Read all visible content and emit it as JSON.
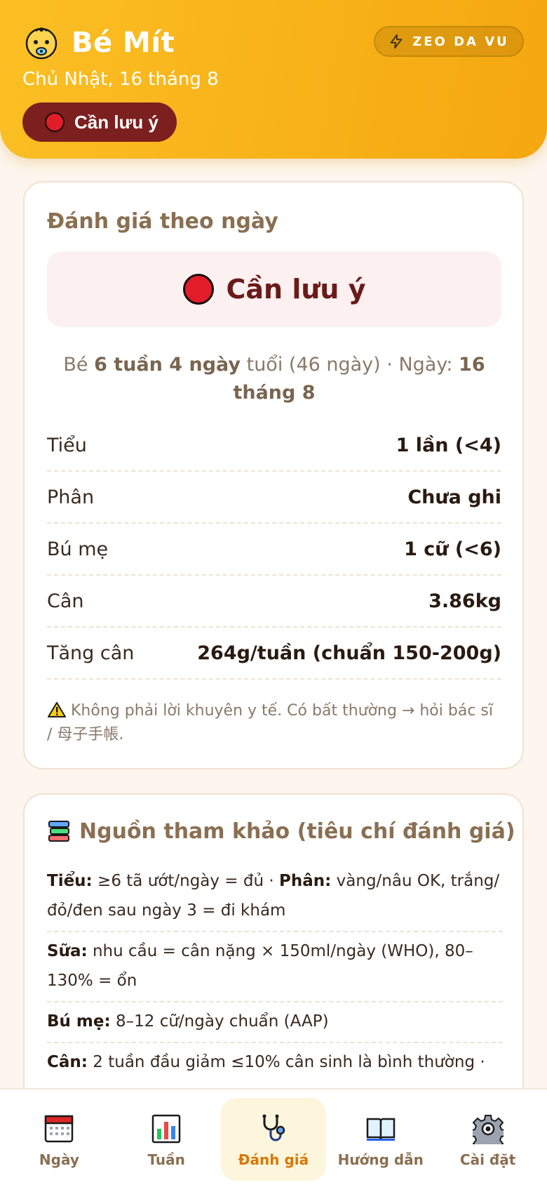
{
  "header": {
    "app_title": "Bé Mít",
    "date": "Chủ Nhật, 16 tháng 8",
    "status_label": "Cần lưu ý",
    "mode_label": "ZEO DA VU",
    "baby_icon": "baby-face-icon",
    "mode_icon": "lightning-icon"
  },
  "assessment": {
    "title": "Đánh giá theo ngày",
    "banner_label": "Cần lưu ý",
    "age_prefix": "Bé",
    "age_bold": "6 tuần 4 ngày",
    "age_suffix": "tuổi (46 ngày) · Ngày:",
    "date_bold": "16 tháng 8",
    "rows": [
      {
        "key": "Tiểu",
        "value": "1 lần (<4)"
      },
      {
        "key": "Phân",
        "value": "Chưa ghi"
      },
      {
        "key": "Bú mẹ",
        "value": "1 cữ (<6)"
      },
      {
        "key": "Cân",
        "value": "3.86kg"
      },
      {
        "key": "Tăng cân",
        "value": "264g/tuần (chuẩn 150-200g)"
      }
    ],
    "disclaimer": "Không phải lời khuyên y tế. Có bất thường → hỏi bác sĩ / 母子手帳."
  },
  "references": {
    "title": "Nguồn tham khảo (tiêu chí đánh giá)",
    "items": [
      {
        "label1": "Tiểu:",
        "text1": " ≥6 tã ướt/ngày = đủ · ",
        "label2": "Phân:",
        "text2": " vàng/nâu OK, trắng/đỏ/đen sau ngày 3 = đi khám"
      },
      {
        "label1": "Sữa:",
        "text1": " nhu cầu = cân nặng × 150ml/ngày (WHO), 80–130% = ổn",
        "label2": "",
        "text2": ""
      },
      {
        "label1": "Bú mẹ:",
        "text1": " 8–12 cữ/ngày chuẩn (AAP)",
        "label2": "",
        "text2": ""
      },
      {
        "label1": "Cân:",
        "text1": " 2 tuần đầu giảm ≤10% cân sinh là bình thường ·",
        "label2": "",
        "text2": ""
      }
    ]
  },
  "nav": {
    "items": [
      {
        "label": "Ngày",
        "icon": "calendar-icon"
      },
      {
        "label": "Tuần",
        "icon": "bar-chart-icon"
      },
      {
        "label": "Đánh giá",
        "icon": "stethoscope-icon",
        "active": true
      },
      {
        "label": "Hướng dẫn",
        "icon": "book-icon"
      },
      {
        "label": "Cài đặt",
        "icon": "gear-icon"
      }
    ]
  },
  "colors": {
    "header_gradient_start": "#fbbf24",
    "header_gradient_end": "#f5a70f",
    "status_dark_red": "#7c1f1f",
    "alert_red": "#e11d2a",
    "active_nav": "#d97706"
  }
}
